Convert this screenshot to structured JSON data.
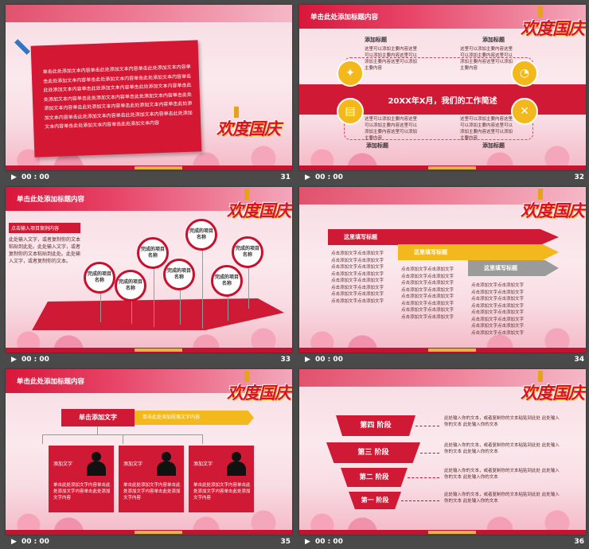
{
  "slides": [
    {
      "number": "31",
      "time": "00 : 00",
      "body_text": "单击此处添加文本内容单击此处添加文本内容单击此处添加文本内容单击此处添加文本内容单击此处添加文本内容单击此处添加文本内容单击此处添加文本内容单击此处添加文本内容单击此处添加文本内容单击此处添加文本内容单击此处添加文本内容单击此处添加文本内容单击此处添加文本内容单击此处添加文本内容单击此处添加文本内容单击此处添加文本内容单击此处添加文本内容单击此处添加文本内容单击此处添加文本内容单击此处添加文本内容单击此处添加文本内容",
      "logo": "欢度国庆"
    },
    {
      "number": "32",
      "time": "00 : 00",
      "title": "单击此处添加标题内容",
      "logo": "欢度国庆",
      "banner": "20XX年X月，我们的工作简述",
      "labels": [
        "添加标题",
        "添加标题",
        "添加标题",
        "添加标题"
      ],
      "desc": "这里可以添加主要内容这里可以添加主要内容这里可以添加主要内容这里可以添加主要内容"
    },
    {
      "number": "33",
      "time": "00 : 00",
      "title": "单击此处添加标题内容",
      "logo": "欢度国庆",
      "side_header": "点击输入项目案例内容",
      "side_text": "此处输入文字，或者复制你的文本粘贴到此处。此处输入文字，或者复制你的文本粘贴到此处。此处输入文字，或者复制你的文本。",
      "pins": [
        "完成的项目名称",
        "完成的项目名称",
        "完成的项目名称",
        "完成的项目名称",
        "完成的项目名称",
        "完成的项目名称",
        "完成的项目名称"
      ]
    },
    {
      "number": "34",
      "time": "00 : 00",
      "logo": "欢度国庆",
      "arrows": [
        "这里填写标题",
        "这里填写标题",
        "这里填写标题"
      ],
      "col_text": "点击添加文字点击添加文字点击添加文字点击添加文字点击添加文字点击添加文字点击添加文字点击添加文字点击添加文字点击添加文字点击添加文字点击添加文字点击添加文字点击添加文字点击添加文字点击添加文字"
    },
    {
      "number": "35",
      "time": "00 : 00",
      "title": "单击此处添加标题内容",
      "logo": "欢度国庆",
      "main_box": "单击添加文字",
      "main_sub": "单击此处添加段落文字内容",
      "cards": [
        {
          "label": "添加文字",
          "text": "单击此处添加文字内容单击此处添加文字内容单击此处添加文字内容"
        },
        {
          "label": "添加文字",
          "text": "单击此处添加文字内容单击此处添加文字内容单击此处添加文字内容"
        },
        {
          "label": "添加文字",
          "text": "单击此处添加文字内容单击此处添加文字内容单击此处添加文字内容"
        }
      ]
    },
    {
      "number": "36",
      "time": "00 : 00",
      "logo": "欢度国庆",
      "stages": [
        "第四 阶段",
        "第三 阶段",
        "第二 阶段",
        "第一 阶段"
      ],
      "stage_text": "此处输入你的文本，或者复制你的文本粘贴到此处 此处输入你的文本 此处输入你的文本"
    }
  ]
}
